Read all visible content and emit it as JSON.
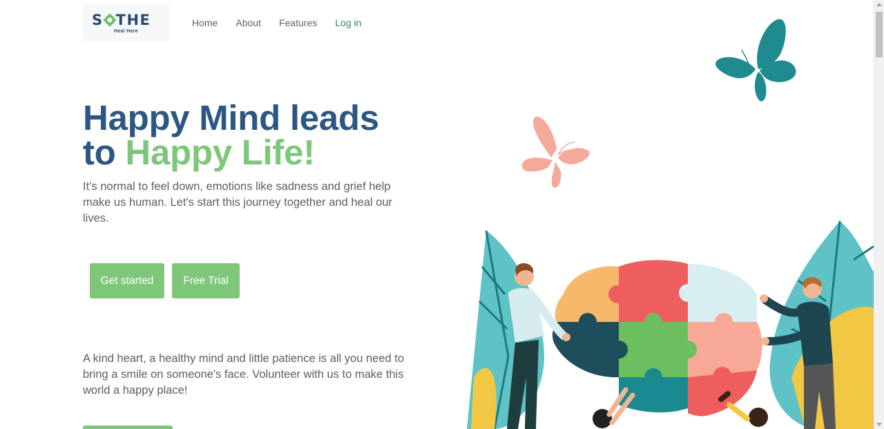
{
  "logo": {
    "name_start": "S",
    "name_end": "THE",
    "tagline": "Heal Here"
  },
  "nav": {
    "items": [
      {
        "label": "Home"
      },
      {
        "label": "About"
      },
      {
        "label": "Features"
      },
      {
        "label": "Log in"
      }
    ]
  },
  "hero": {
    "headline_line1": "Happy Mind leads",
    "headline_to": "to ",
    "headline_highlight": "Happy Life!",
    "lead": "It’s normal to feel down, emotions like sadness and grief help make us human. Let's start this journey together and heal our lives.",
    "primary_button": "Get started",
    "secondary_button": "Free Trial"
  },
  "volunteer": {
    "text": "A kind heart, a healthy mind and little patience is all you need to bring a smile on someone's face. Volunteer with us to make this world a happy place!"
  },
  "colors": {
    "headline_blue": "#2d5783",
    "accent_green": "#7ec77a",
    "login_green": "#2e8b57",
    "butterfly_teal": "#1f8a8f",
    "butterfly_pink": "#f4a99a"
  },
  "icons": {
    "logo_mark": "lotus-icon",
    "butterflies": "butterfly-icon"
  }
}
